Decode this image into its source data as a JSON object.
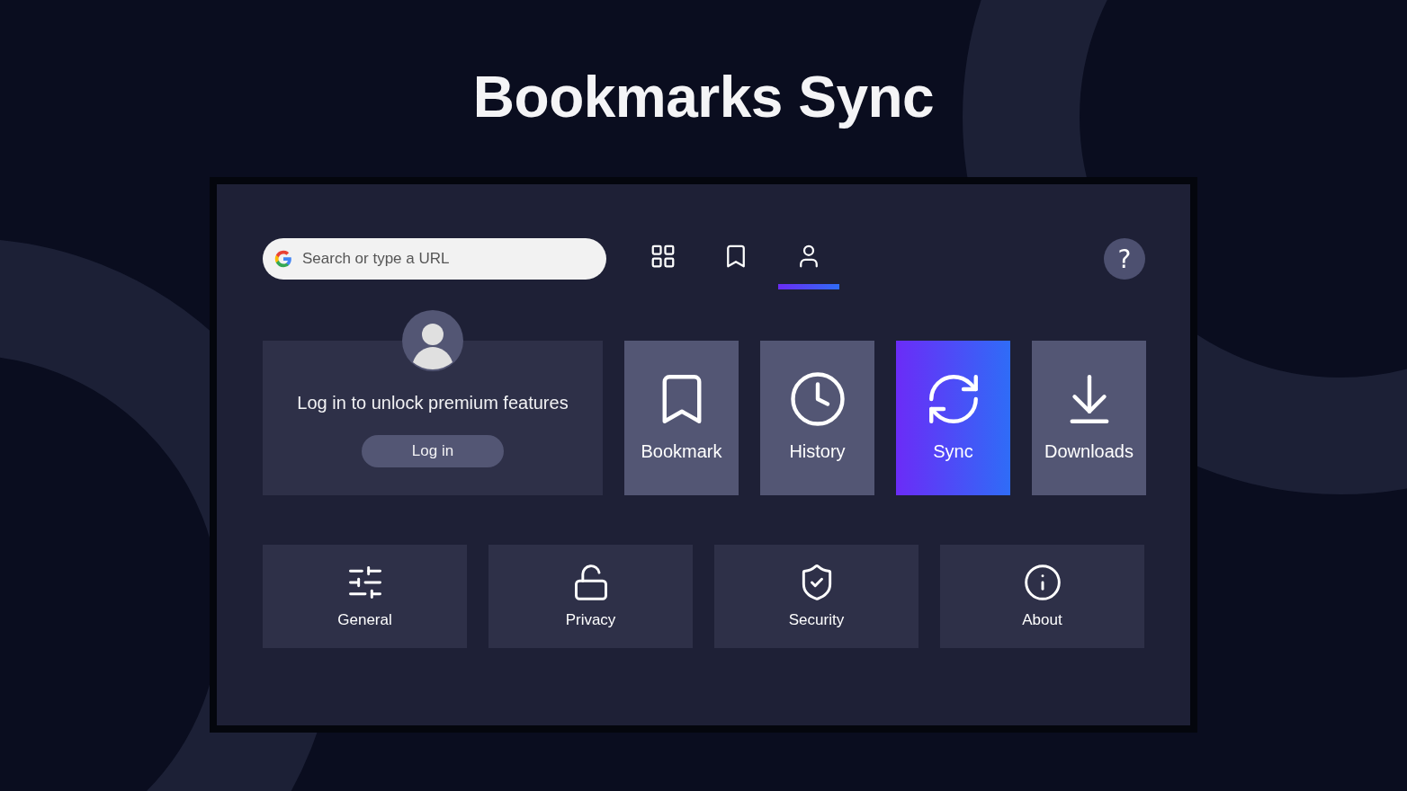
{
  "title": "Bookmarks Sync",
  "toolbar": {
    "search": {
      "placeholder": "Search or type a URL"
    },
    "tabs": [
      {
        "kind": "grid",
        "selected": false
      },
      {
        "kind": "bookmark",
        "selected": false
      },
      {
        "kind": "profile",
        "selected": true
      }
    ],
    "help": {
      "label": "?"
    }
  },
  "login_card": {
    "message": "Log in to unlock premium features",
    "button": "Log in"
  },
  "tiles": [
    {
      "kind": "bookmark",
      "label": "Bookmark",
      "selected": false
    },
    {
      "kind": "history",
      "label": "History",
      "selected": false
    },
    {
      "kind": "sync",
      "label": "Sync",
      "selected": true
    },
    {
      "kind": "downloads",
      "label": "Downloads",
      "selected": false
    }
  ],
  "settings": [
    {
      "kind": "general",
      "label": "General"
    },
    {
      "kind": "privacy",
      "label": "Privacy"
    },
    {
      "kind": "security",
      "label": "Security"
    },
    {
      "kind": "about",
      "label": "About"
    }
  ]
}
